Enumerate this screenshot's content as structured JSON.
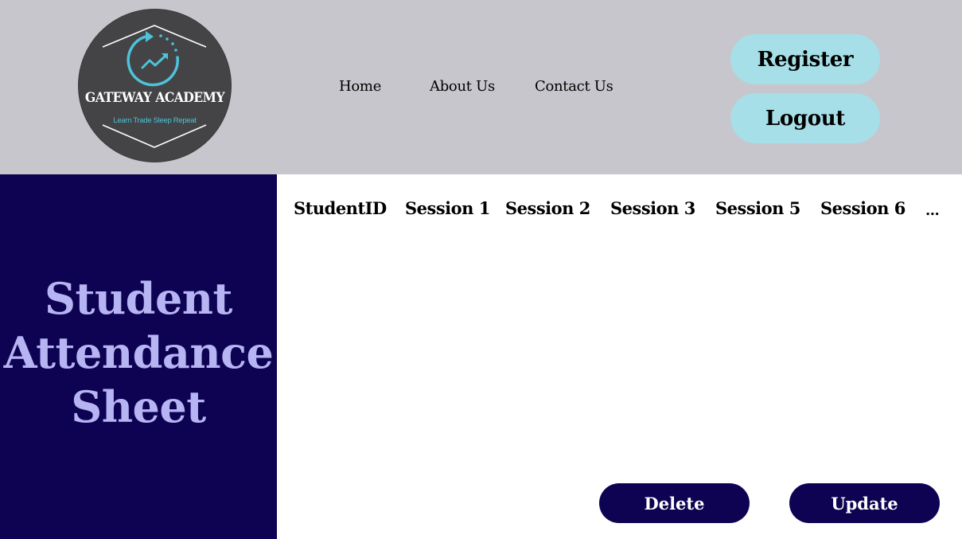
{
  "logo": {
    "title": "GATEWAY ACADEMY",
    "tagline": "Learn Trade Sleep Repeat",
    "icon": "rising-chart-cycle-icon"
  },
  "nav": {
    "home": "Home",
    "about": "About Us",
    "contact": "Contact Us"
  },
  "auth": {
    "register": "Register",
    "logout": "Logout"
  },
  "sidebar": {
    "title_lines": [
      "Student",
      "Attendance",
      "Sheet"
    ]
  },
  "table": {
    "headers": [
      "StudentID",
      "Session 1",
      "Session 2",
      "Session 3",
      "Session 5",
      "Session 6",
      "..."
    ]
  },
  "actions": {
    "delete": "Delete",
    "update": "Update"
  },
  "colors": {
    "header_bg": "#c7c6cc",
    "sidebar_bg": "#0e0352",
    "title_text": "#b6b4f3",
    "pill_bg": "#a6dfe7",
    "logo_accent": "#4cc3d9"
  }
}
